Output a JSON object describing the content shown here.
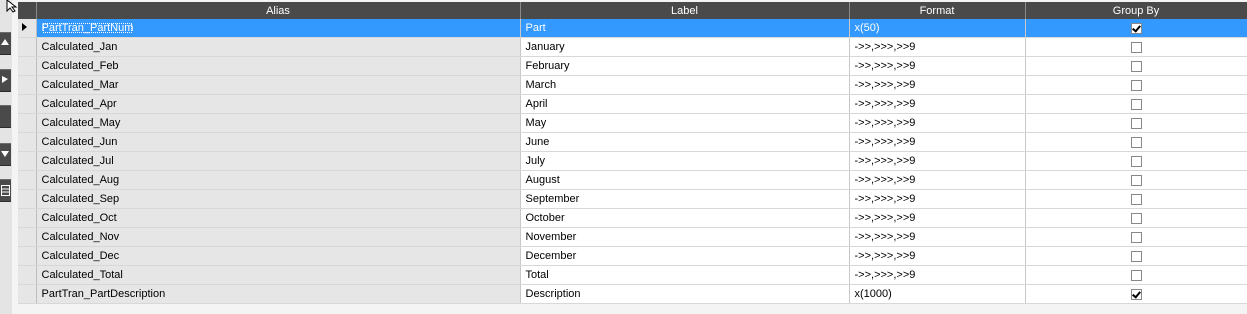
{
  "columns": [
    "Alias",
    "Label",
    "Format",
    "Group By"
  ],
  "rows": [
    {
      "alias": "PartTran_PartNum",
      "label": "Part",
      "format": "x(50)",
      "group_by": true
    },
    {
      "alias": "Calculated_Jan",
      "label": "January",
      "format": "->>,>>>,>>9",
      "group_by": false
    },
    {
      "alias": "Calculated_Feb",
      "label": "February",
      "format": "->>,>>>,>>9",
      "group_by": false
    },
    {
      "alias": "Calculated_Mar",
      "label": "March",
      "format": "->>,>>>,>>9",
      "group_by": false
    },
    {
      "alias": "Calculated_Apr",
      "label": "April",
      "format": "->>,>>>,>>9",
      "group_by": false
    },
    {
      "alias": "Calculated_May",
      "label": "May",
      "format": "->>,>>>,>>9",
      "group_by": false
    },
    {
      "alias": "Calculated_Jun",
      "label": "June",
      "format": "->>,>>>,>>9",
      "group_by": false
    },
    {
      "alias": "Calculated_Jul",
      "label": "July",
      "format": "->>,>>>,>>9",
      "group_by": false
    },
    {
      "alias": "Calculated_Aug",
      "label": "August",
      "format": "->>,>>>,>>9",
      "group_by": false
    },
    {
      "alias": "Calculated_Sep",
      "label": "September",
      "format": "->>,>>>,>>9",
      "group_by": false
    },
    {
      "alias": "Calculated_Oct",
      "label": "October",
      "format": "->>,>>>,>>9",
      "group_by": false
    },
    {
      "alias": "Calculated_Nov",
      "label": "November",
      "format": "->>,>>>,>>9",
      "group_by": false
    },
    {
      "alias": "Calculated_Dec",
      "label": "December",
      "format": "->>,>>>,>>9",
      "group_by": false
    },
    {
      "alias": "Calculated_Total",
      "label": "Total",
      "format": "->>,>>>,>>9",
      "group_by": false
    },
    {
      "alias": "PartTran_PartDescription",
      "label": "Description",
      "format": "x(1000)",
      "group_by": true
    }
  ],
  "selected_row": 0,
  "toolbar_icons": [
    "move-top-icon",
    "move-up-icon",
    "blank-icon",
    "move-down-icon",
    "grid-icon"
  ],
  "colors": {
    "header_bg": "#4a4a4a",
    "selection": "#3399ff"
  }
}
